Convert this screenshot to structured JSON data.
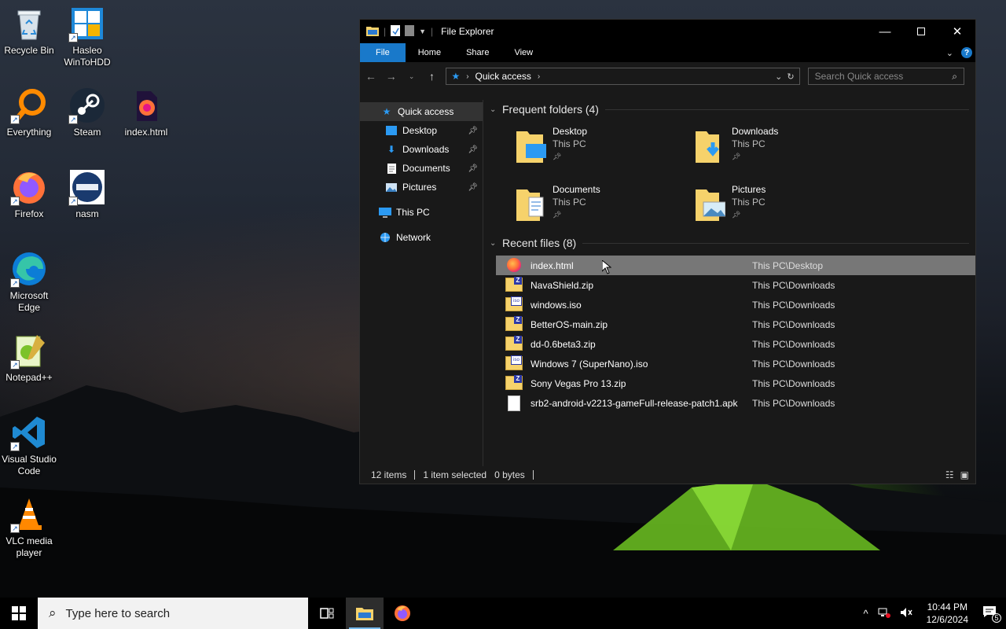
{
  "desktop": {
    "icons": [
      {
        "label": "Recycle Bin"
      },
      {
        "label": "Hasleo WinToHDD"
      },
      {
        "label": "Everything"
      },
      {
        "label": "Steam"
      },
      {
        "label": "index.html"
      },
      {
        "label": "Firefox"
      },
      {
        "label": "nasm"
      },
      {
        "label": "Microsoft Edge"
      },
      {
        "label": "Notepad++"
      },
      {
        "label": "Visual Studio Code"
      },
      {
        "label": "VLC media player"
      }
    ]
  },
  "explorer": {
    "title": "File Explorer",
    "ribbon_tabs": [
      "File",
      "Home",
      "Share",
      "View"
    ],
    "address": "Quick access",
    "search_placeholder": "Search Quick access",
    "nav": {
      "quick_access": "Quick access",
      "pinned": [
        "Desktop",
        "Downloads",
        "Documents",
        "Pictures"
      ],
      "this_pc": "This PC",
      "network": "Network"
    },
    "frequent_header": "Frequent folders (4)",
    "frequent": [
      {
        "name": "Desktop",
        "location": "This PC"
      },
      {
        "name": "Downloads",
        "location": "This PC"
      },
      {
        "name": "Documents",
        "location": "This PC"
      },
      {
        "name": "Pictures",
        "location": "This PC"
      }
    ],
    "recent_header": "Recent files (8)",
    "recent": [
      {
        "name": "index.html",
        "location": "This PC\\Desktop",
        "type": "html"
      },
      {
        "name": "NavaShield.zip",
        "location": "This PC\\Downloads",
        "type": "zip"
      },
      {
        "name": "windows.iso",
        "location": "This PC\\Downloads",
        "type": "iso"
      },
      {
        "name": "BetterOS-main.zip",
        "location": "This PC\\Downloads",
        "type": "zip"
      },
      {
        "name": "dd-0.6beta3.zip",
        "location": "This PC\\Downloads",
        "type": "zip"
      },
      {
        "name": "Windows 7 (SuperNano).iso",
        "location": "This PC\\Downloads",
        "type": "iso"
      },
      {
        "name": "Sony Vegas Pro 13.zip",
        "location": "This PC\\Downloads",
        "type": "zip"
      },
      {
        "name": "srb2-android-v2213-gameFull-release-patch1.apk",
        "location": "This PC\\Downloads",
        "type": "file"
      }
    ],
    "status": {
      "items": "12 items",
      "selected": "1 item selected",
      "size": "0 bytes"
    }
  },
  "taskbar": {
    "search_placeholder": "Type here to search",
    "time": "10:44 PM",
    "date": "12/6/2024",
    "notification_count": "5"
  },
  "colors": {
    "accent": "#1979ca",
    "window_bg": "#191919",
    "selected_row": "#777777"
  }
}
